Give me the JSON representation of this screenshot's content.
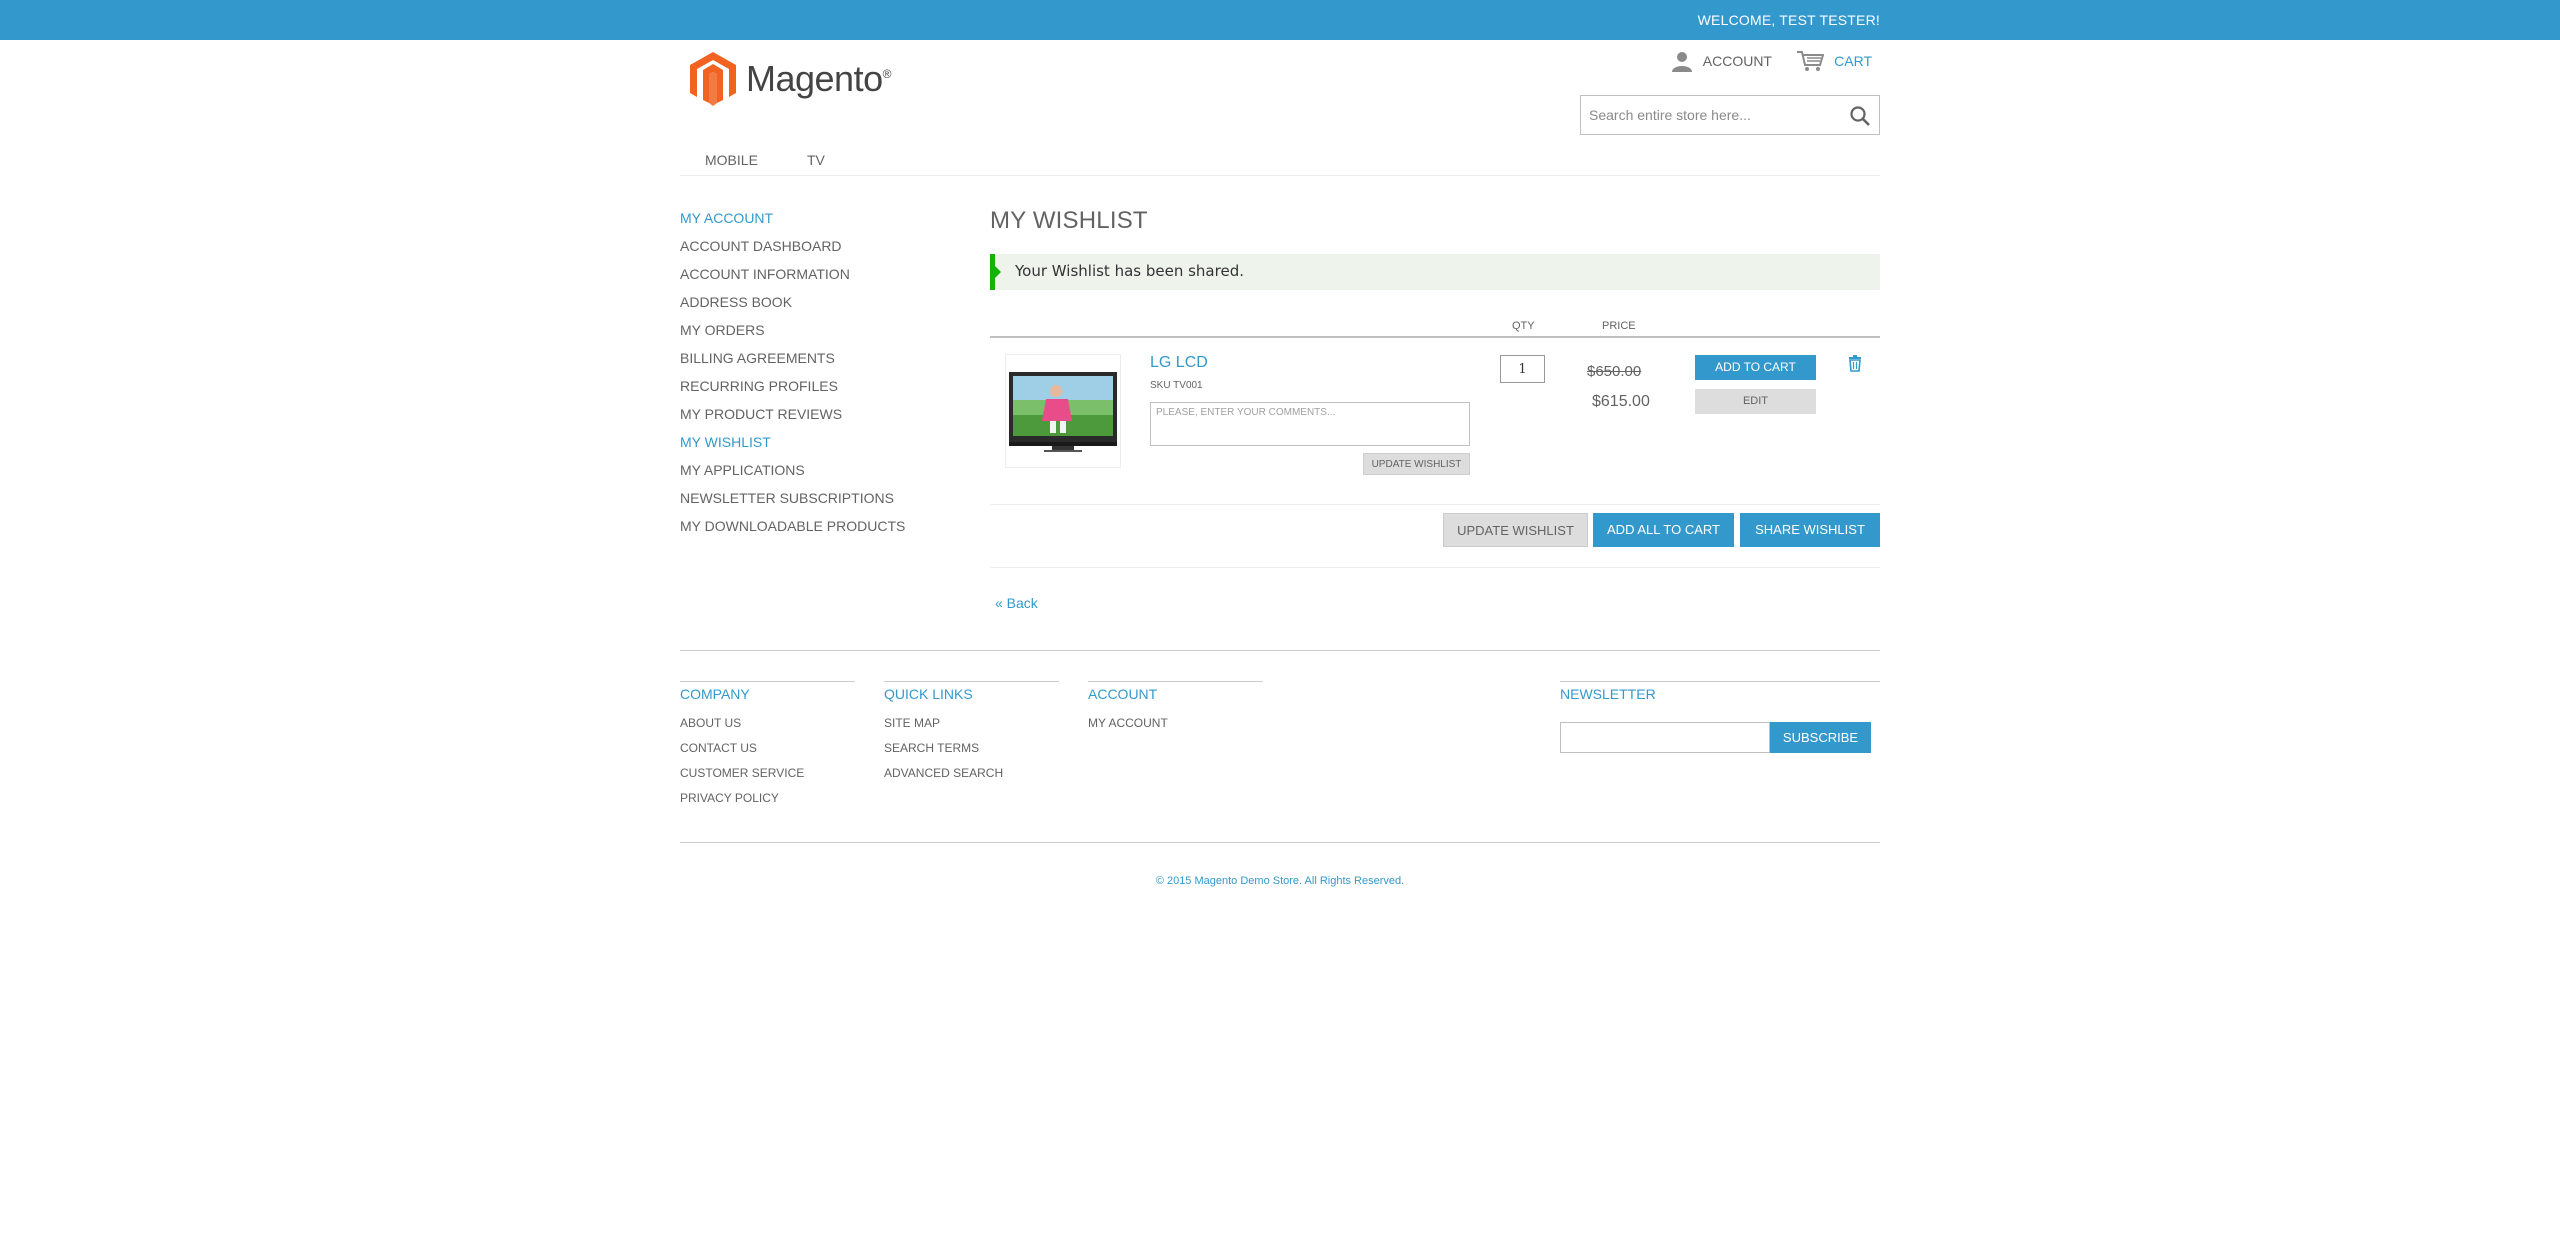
{
  "topbar": {
    "welcome": "WELCOME, TEST TESTER!"
  },
  "header": {
    "logo_text": "Magento",
    "logo_mark": "®",
    "account_label": "ACCOUNT",
    "cart_label": "CART",
    "search_placeholder": "Search entire store here..."
  },
  "nav": {
    "items": [
      "MOBILE",
      "TV"
    ]
  },
  "sidebar": {
    "title": "MY ACCOUNT",
    "items": [
      "ACCOUNT DASHBOARD",
      "ACCOUNT INFORMATION",
      "ADDRESS BOOK",
      "MY ORDERS",
      "BILLING AGREEMENTS",
      "RECURRING PROFILES",
      "MY PRODUCT REVIEWS",
      "MY WISHLIST",
      "MY APPLICATIONS",
      "NEWSLETTER SUBSCRIPTIONS",
      "MY DOWNLOADABLE PRODUCTS"
    ],
    "active_index": 7
  },
  "main": {
    "title": "MY WISHLIST",
    "success_message": "Your Wishlist has been shared.",
    "columns": {
      "qty": "QTY",
      "price": "PRICE"
    },
    "item": {
      "name": "LG LCD",
      "sku": "SKU TV001",
      "comment_placeholder": "PLEASE, ENTER YOUR COMMENTS...",
      "update_label": "UPDATE WISHLIST",
      "qty": "1",
      "old_price": "$650.00",
      "new_price": "$615.00",
      "add_to_cart_label": "ADD TO CART",
      "edit_label": "EDIT"
    },
    "actions": {
      "update": "UPDATE WISHLIST",
      "add_all": "ADD ALL TO CART",
      "share": "SHARE WISHLIST"
    },
    "back": "« Back"
  },
  "footer": {
    "company": {
      "title": "COMPANY",
      "links": [
        "ABOUT US",
        "CONTACT US",
        "CUSTOMER SERVICE",
        "PRIVACY POLICY"
      ]
    },
    "quick_links": {
      "title": "QUICK LINKS",
      "links": [
        "SITE MAP",
        "SEARCH TERMS",
        "ADVANCED SEARCH"
      ]
    },
    "account": {
      "title": "ACCOUNT",
      "links": [
        "MY ACCOUNT"
      ]
    },
    "newsletter": {
      "title": "NEWSLETTER",
      "subscribe": "SUBSCRIBE"
    },
    "copyright": "© 2015 Magento Demo Store. All Rights Reserved."
  },
  "colors": {
    "accent": "#3399cc",
    "success": "#11b400",
    "text": "#636363"
  },
  "icons": {
    "account": "user-icon",
    "cart": "cart-icon",
    "search": "search-icon",
    "delete": "trash-icon"
  }
}
